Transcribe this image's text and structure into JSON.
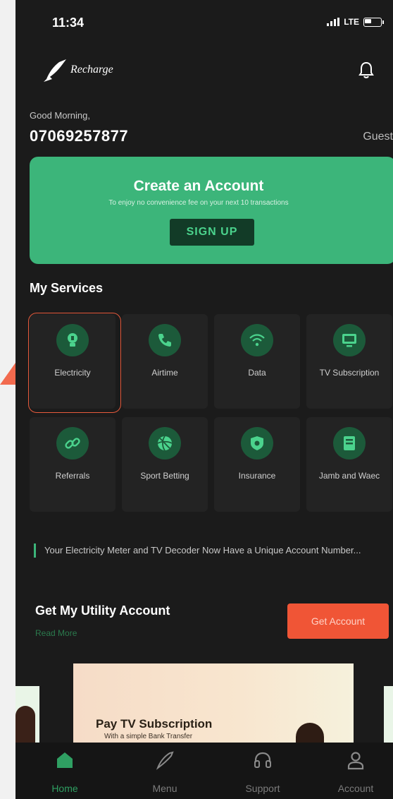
{
  "status": {
    "time": "11:34",
    "network": "LTE"
  },
  "brand": {
    "name": "Recharge"
  },
  "greeting": "Good Morning,",
  "user": {
    "phone": "07069257877",
    "role": "Guest"
  },
  "banner": {
    "title": "Create an Account",
    "subtitle": "To enjoy no convenience fee on your next 10 transactions",
    "button": "SIGN UP"
  },
  "services": {
    "title": "My Services",
    "items": [
      {
        "label": "Electricity",
        "icon": "bulb-icon"
      },
      {
        "label": "Airtime",
        "icon": "phone-icon"
      },
      {
        "label": "Data",
        "icon": "wifi-icon"
      },
      {
        "label": "TV Subscription",
        "icon": "tv-icon"
      },
      {
        "label": "Referrals",
        "icon": "link-icon"
      },
      {
        "label": "Sport Betting",
        "icon": "ball-icon"
      },
      {
        "label": "Insurance",
        "icon": "shield-icon"
      },
      {
        "label": "Jamb and Waec",
        "icon": "book-icon"
      }
    ]
  },
  "notice": "Your Electricity Meter and TV Decoder Now Have a Unique Account Number...",
  "utility": {
    "title": "Get My Utility Account",
    "read_more": "Read More",
    "button": "Get Account"
  },
  "promo": {
    "title": "Pay TV Subscription",
    "subtitle": "With a simple Bank Transfer"
  },
  "nav": [
    {
      "label": "Home",
      "icon": "home-icon",
      "active": true
    },
    {
      "label": "Menu",
      "icon": "menu-icon"
    },
    {
      "label": "Support",
      "icon": "headphones-icon"
    },
    {
      "label": "Account",
      "icon": "user-icon"
    }
  ],
  "colors": {
    "accent": "#3cb57a",
    "cta": "#f05536",
    "highlight": "#e65a3c",
    "background": "#1b1b1b"
  }
}
